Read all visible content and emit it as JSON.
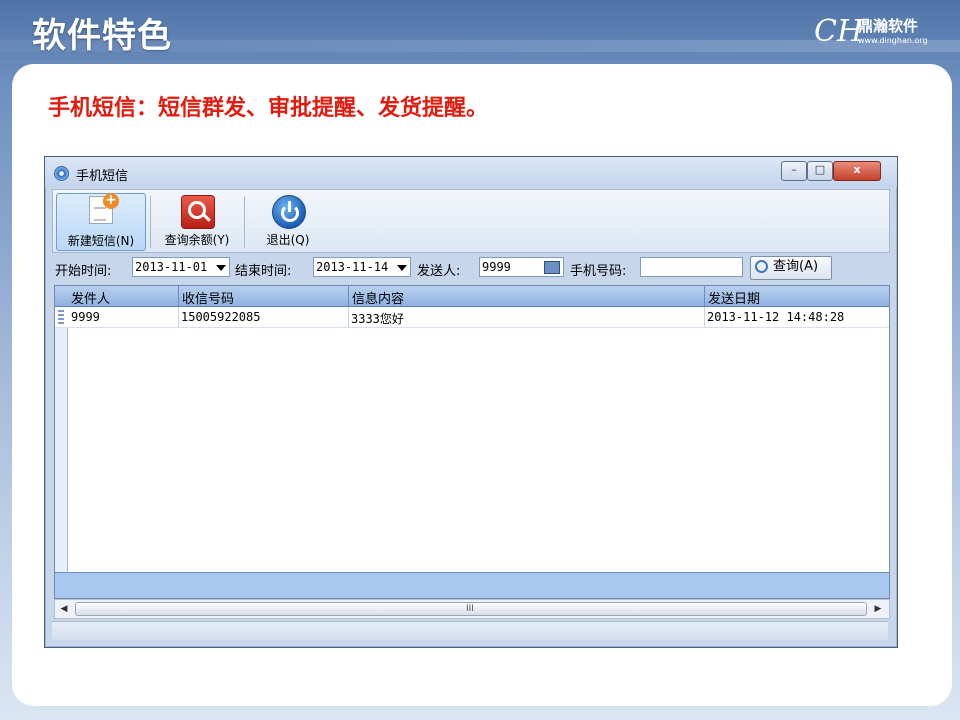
{
  "slide": {
    "title": "软件特色",
    "headline": "手机短信：短信群发、审批提醒、发货提醒。",
    "logo_mark": "CH",
    "logo_text": "鼎瀚软件",
    "logo_url": "www.dinghan.org"
  },
  "window": {
    "title": "手机短信",
    "icon": "app-icon",
    "controls": {
      "minimize": "–",
      "maximize": "□",
      "close": "x"
    }
  },
  "toolbar": {
    "buttons": [
      {
        "label": "新建短信(N)",
        "icon": "new-message-icon"
      },
      {
        "label": "查询余额(Y)",
        "icon": "query-balance-icon"
      },
      {
        "label": "退出(Q)",
        "icon": "exit-icon"
      }
    ]
  },
  "filters": {
    "start_label": "开始时间:",
    "start_value": "2013-11-01",
    "end_label": "结束时间:",
    "end_value": "2013-11-14",
    "sender_label": "发送人:",
    "sender_value": "9999",
    "phone_label": "手机号码:",
    "phone_value": "",
    "query_button": "查询(A)"
  },
  "grid": {
    "columns": [
      "发件人",
      "收信号码",
      "信息内容",
      "发送日期"
    ],
    "rows": [
      [
        "9999",
        "15005922085",
        "3333您好",
        "2013-11-12 14:48:28"
      ]
    ]
  },
  "scrollbar": {
    "grip": "III"
  },
  "colors": {
    "headline": "#e11c0f",
    "grid_header": "#9fbde6",
    "grid_footer": "#a9c6ef",
    "close_button": "#c4412c"
  }
}
